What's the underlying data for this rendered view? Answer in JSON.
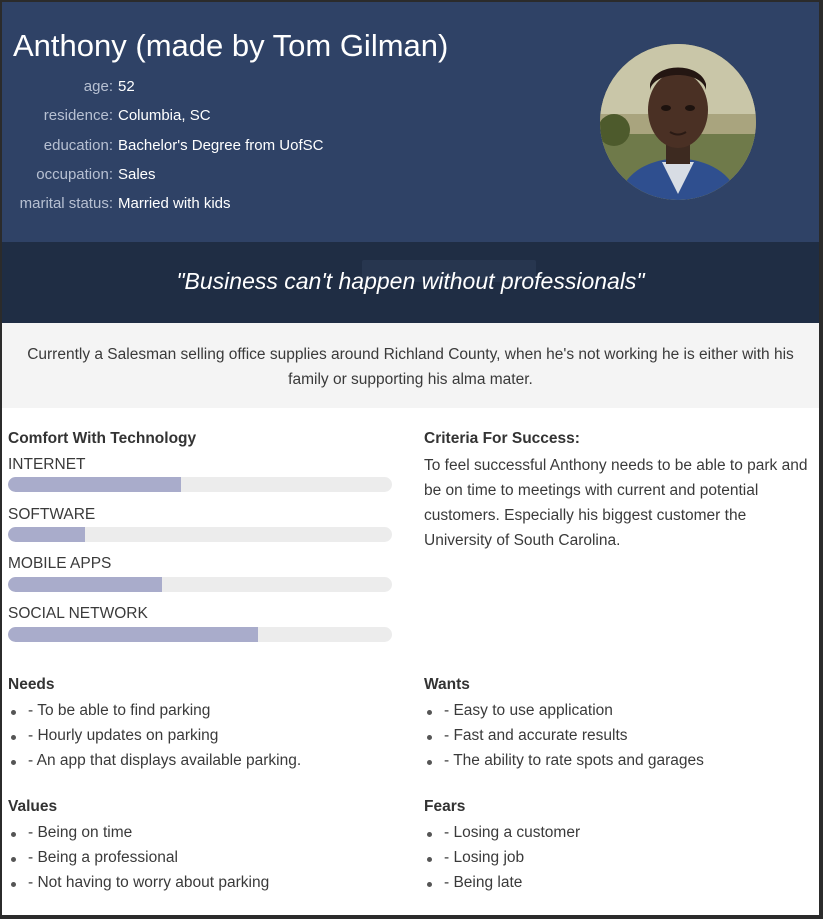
{
  "persona": {
    "name": "Anthony (made by Tom Gilman)",
    "facts": [
      {
        "label": "age:",
        "value": "52"
      },
      {
        "label": "residence:",
        "value": "Columbia, SC"
      },
      {
        "label": "education:",
        "value": "Bachelor's Degree from UofSC"
      },
      {
        "label": "occupation:",
        "value": "Sales"
      },
      {
        "label": "marital status:",
        "value": "Married with kids"
      }
    ],
    "quote": "\"Business can't happen without professionals\"",
    "summary": "Currently a Salesman selling office supplies around Richland County, when he's not working he is either with his family or supporting his alma mater."
  },
  "technology": {
    "title": "Comfort With Technology",
    "items": [
      {
        "label": "INTERNET",
        "level": 0.45
      },
      {
        "label": "SOFTWARE",
        "level": 0.2
      },
      {
        "label": "MOBILE APPS",
        "level": 0.4
      },
      {
        "label": "SOCIAL NETWORK",
        "level": 0.65
      }
    ]
  },
  "criteria": {
    "title": "Criteria For Success:",
    "text": "To feel successful Anthony needs to be able to park and be on time to meetings with current and potential customers. Especially his biggest customer the University of South Carolina."
  },
  "needs": {
    "title": "Needs",
    "items": [
      "- To be able to find parking",
      "- Hourly updates on parking",
      "- An app that displays available parking."
    ]
  },
  "wants": {
    "title": "Wants",
    "items": [
      "- Easy to use application",
      "- Fast and accurate results",
      "- The ability to rate spots and garages"
    ]
  },
  "values": {
    "title": "Values",
    "items": [
      "- Being on time",
      "- Being a professional",
      "- Not having to worry about parking"
    ]
  },
  "fears": {
    "title": "Fears",
    "items": [
      "- Losing a customer",
      "- Losing job",
      "- Being late"
    ]
  },
  "colors": {
    "header": "#2f4266",
    "quote_band": "#1f2d44",
    "bar_fill": "#a9accb",
    "bar_track": "#ececec"
  }
}
